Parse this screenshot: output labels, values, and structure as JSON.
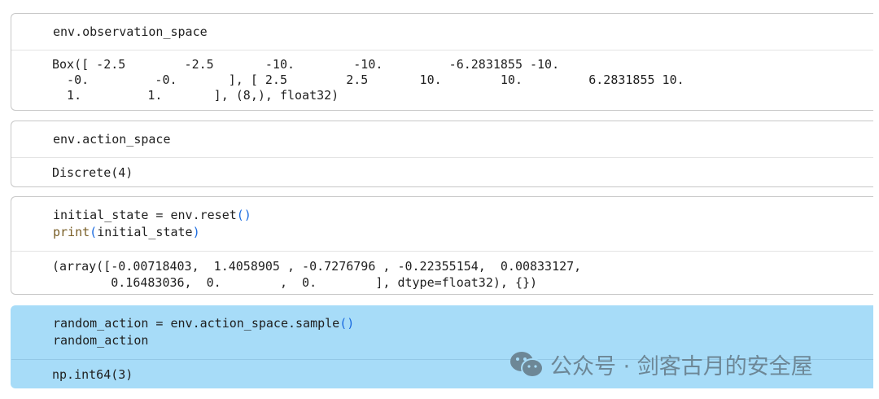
{
  "cells": [
    {
      "input": "env.observation_space",
      "output": "Box([ -2.5        -2.5       -10.        -10.         -6.2831855 -10.\n  -0.         -0.       ], [ 2.5        2.5       10.        10.         6.2831855 10.\n  1.         1.       ], (8,), float32)"
    },
    {
      "input": "env.action_space",
      "output": "Discrete(4)"
    },
    {
      "input_line1_pre": "initial_state = env.reset",
      "input_line2_fn": "print",
      "input_line2_arg": "initial_state",
      "output": "(array([-0.00718403,  1.4058905 , -0.7276796 , -0.22355154,  0.00833127,\n        0.16483036,  0.        ,  0.        ], dtype=float32), {})"
    },
    {
      "input_line1_pre": "random_action = env.action_space.sample",
      "input_line2": "random_action",
      "output": "np.int64(3)"
    }
  ],
  "watermark": "公众号 · 剑客古月的安全屋",
  "colors": {
    "selected_cell": "#a7dcf8",
    "function": "#795e26",
    "paren": "#1a6be0"
  }
}
